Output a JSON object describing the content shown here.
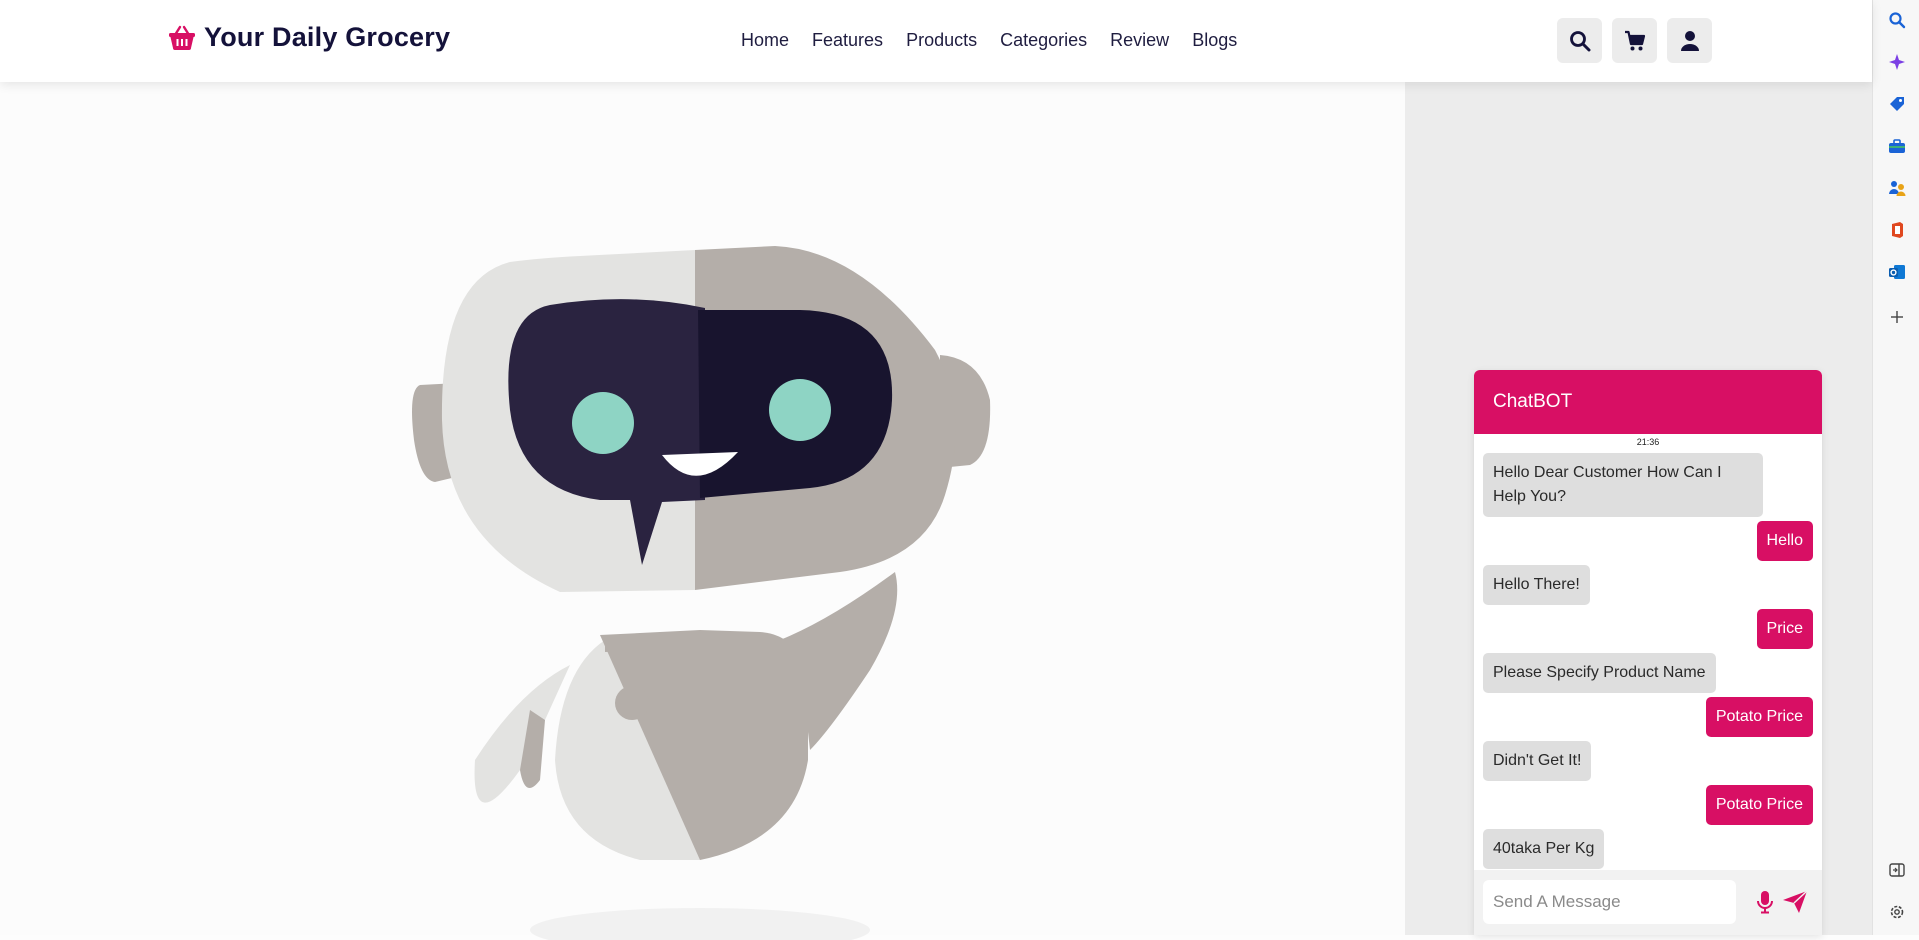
{
  "header": {
    "brand": "Your Daily Grocery",
    "nav": [
      "Home",
      "Features",
      "Products",
      "Categories",
      "Review",
      "Blogs"
    ],
    "icons": [
      "search-icon",
      "cart-icon",
      "user-icon"
    ]
  },
  "chatbot": {
    "title": "ChatBOT",
    "time": "21:36",
    "messages": [
      {
        "from": "bot",
        "text": "Hello Dear Customer How Can I Help You?"
      },
      {
        "from": "user",
        "text": "Hello"
      },
      {
        "from": "bot",
        "text": "Hello There!"
      },
      {
        "from": "user",
        "text": "Price"
      },
      {
        "from": "bot",
        "text": "Please Specify Product Name"
      },
      {
        "from": "user",
        "text": "Potato Price"
      },
      {
        "from": "bot",
        "text": "Didn't Get It!"
      },
      {
        "from": "user",
        "text": "Potato Price"
      },
      {
        "from": "bot",
        "text": "40taka Per Kg"
      }
    ],
    "input_placeholder": "Send A Message",
    "input_value": ""
  },
  "colors": {
    "accent": "#d80f64",
    "brand_text": "#14123a",
    "bot_bubble": "#dedede"
  },
  "edge_sidebar": {
    "icons": [
      "search-icon",
      "copilot-icon",
      "tag-icon",
      "toolbox-icon",
      "people-icon",
      "office-icon",
      "outlook-icon",
      "add-icon",
      "sidebar-toggle-icon",
      "settings-icon"
    ]
  }
}
